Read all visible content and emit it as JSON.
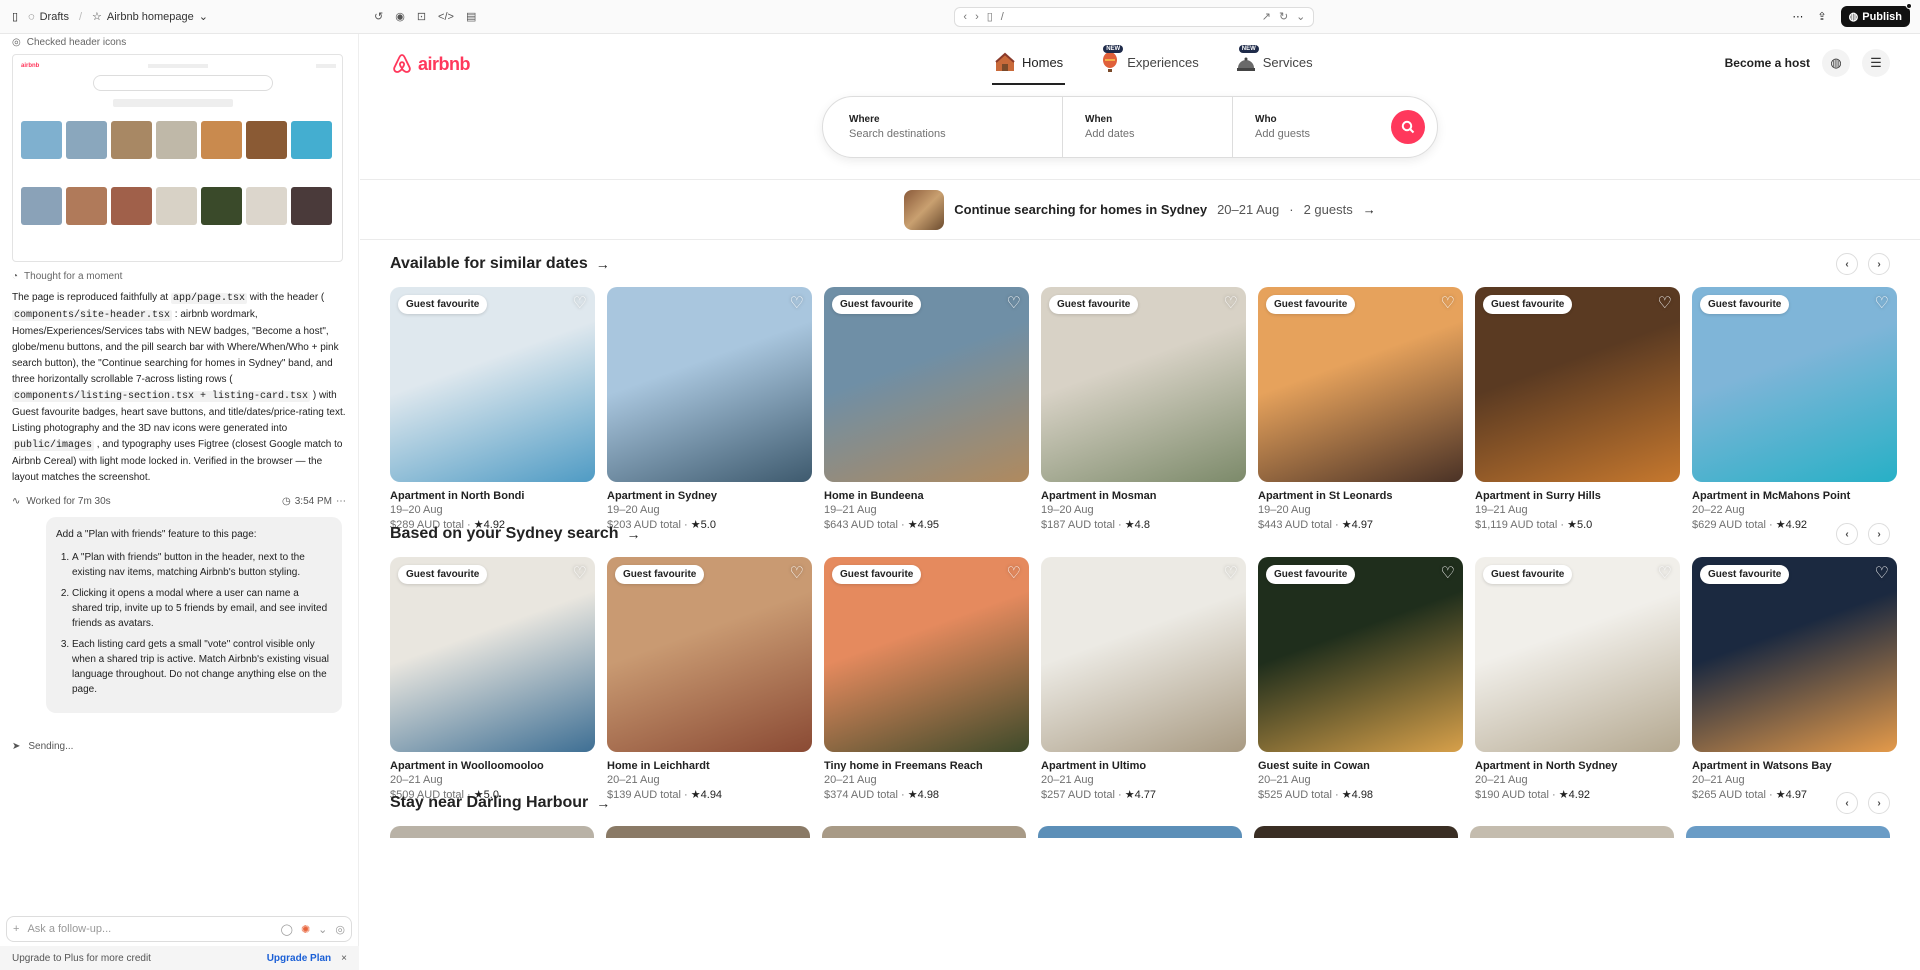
{
  "topbar": {
    "drafts": "Drafts",
    "project": "Airbnb homepage",
    "url": "/",
    "publish": "Publish"
  },
  "chat": {
    "checked": "Checked header icons",
    "thought": "Thought for a moment",
    "summary": {
      "p1": "The page is reproduced faithfully at ",
      "c1": "app/page.tsx",
      "p2": " with the header ( ",
      "c2": "components/site-header.tsx",
      "p3": " : airbnb wordmark, Homes/Experiences/Services tabs with NEW badges, \"Become a host\", globe/menu buttons, and the pill search bar with Where/When/Who + pink search button), the \"Continue searching for homes in Sydney\" band, and three horizontally scrollable 7-across listing rows ( ",
      "c3": "components/listing-section.tsx + listing-card.tsx",
      "p4": " ) with Guest favourite badges, heart save buttons, and title/dates/price-rating text. Listing photography and the 3D nav icons were generated into ",
      "c4": "public/images",
      "p5": " , and typography uses Figtree (closest Google match to Airbnb Cereal) with light mode locked in. Verified in the browser — the layout matches the screenshot."
    },
    "worked": "Worked for 7m 30s",
    "time": "3:54 PM",
    "prompt": {
      "intro": "Add a \"Plan with friends\" feature to this page:",
      "items": [
        "A \"Plan with friends\" button in the header, next to the existing nav items, matching Airbnb's button styling.",
        "Clicking it opens a modal where a user can name a shared trip, invite up to 5 friends by email, and see invited friends as avatars.",
        "Each listing card gets a small \"vote\" control visible only when a shared trip is active. Match Airbnb's existing visual language throughout. Do not change anything else on the page."
      ]
    },
    "sending": "Sending...",
    "composer_placeholder": "Ask a follow-up...",
    "upgrade_text": "Upgrade to Plus for more credit",
    "upgrade_link": "Upgrade Plan"
  },
  "site": {
    "logo": "airbnb",
    "nav": [
      {
        "label": "Homes",
        "badge": ""
      },
      {
        "label": "Experiences",
        "badge": "NEW"
      },
      {
        "label": "Services",
        "badge": "NEW"
      }
    ],
    "become_host": "Become a host",
    "search": {
      "where_label": "Where",
      "where_val": "Search destinations",
      "when_label": "When",
      "when_val": "Add dates",
      "who_label": "Who",
      "who_val": "Add guests"
    },
    "band": {
      "title": "Continue searching for homes in Sydney",
      "dates": "20–21 Aug",
      "guests": "2 guests"
    },
    "badge_text": "Guest favourite",
    "sections": [
      {
        "title": "Available for similar dates",
        "cards": [
          {
            "title": "Apartment in North Bondi",
            "dates": "19–20 Aug",
            "price": "$289 AUD total",
            "rating": "★4.92",
            "fav": true,
            "c1": "#dfe8ee",
            "c2": "#4f9bc4"
          },
          {
            "title": "Apartment in Sydney",
            "dates": "19–20 Aug",
            "price": "$203 AUD total",
            "rating": "★5.0",
            "fav": false,
            "c1": "#a9c6de",
            "c2": "#3e5a6e"
          },
          {
            "title": "Home in Bundeena",
            "dates": "19–21 Aug",
            "price": "$643 AUD total",
            "rating": "★4.95",
            "fav": true,
            "c1": "#6f8fa6",
            "c2": "#b08a5e"
          },
          {
            "title": "Apartment in Mosman",
            "dates": "19–20 Aug",
            "price": "$187 AUD total",
            "rating": "★4.8",
            "fav": true,
            "c1": "#d8d2c6",
            "c2": "#7c8a6a"
          },
          {
            "title": "Apartment in St Leonards",
            "dates": "19–20 Aug",
            "price": "$443 AUD total",
            "rating": "★4.97",
            "fav": true,
            "c1": "#e6a25c",
            "c2": "#4a3226"
          },
          {
            "title": "Apartment in Surry Hills",
            "dates": "19–21 Aug",
            "price": "$1,119 AUD total",
            "rating": "★5.0",
            "fav": true,
            "c1": "#5a3a22",
            "c2": "#c6782e"
          },
          {
            "title": "Apartment in McMahons Point",
            "dates": "20–22 Aug",
            "price": "$629 AUD total",
            "rating": "★4.92",
            "fav": true,
            "c1": "#7fb5d8",
            "c2": "#27b0c6"
          }
        ]
      },
      {
        "title": "Based on your Sydney search",
        "cards": [
          {
            "title": "Apartment in Woolloomooloo",
            "dates": "20–21 Aug",
            "price": "$509 AUD total",
            "rating": "★5.0",
            "fav": true,
            "c1": "#e9e6df",
            "c2": "#3e6f94"
          },
          {
            "title": "Home in Leichhardt",
            "dates": "20–21 Aug",
            "price": "$139 AUD total",
            "rating": "★4.94",
            "fav": true,
            "c1": "#c99a72",
            "c2": "#8a4a34"
          },
          {
            "title": "Tiny home in Freemans Reach",
            "dates": "20–21 Aug",
            "price": "$374 AUD total",
            "rating": "★4.98",
            "fav": true,
            "c1": "#e58a5e",
            "c2": "#3e4a2a"
          },
          {
            "title": "Apartment in Ultimo",
            "dates": "20–21 Aug",
            "price": "$257 AUD total",
            "rating": "★4.77",
            "fav": false,
            "c1": "#eceae4",
            "c2": "#a89a82"
          },
          {
            "title": "Guest suite in Cowan",
            "dates": "20–21 Aug",
            "price": "$525 AUD total",
            "rating": "★4.98",
            "fav": true,
            "c1": "#1f2e1c",
            "c2": "#d7a04a"
          },
          {
            "title": "Apartment in North Sydney",
            "dates": "20–21 Aug",
            "price": "$190 AUD total",
            "rating": "★4.92",
            "fav": true,
            "c1": "#f1efea",
            "c2": "#b4a890"
          },
          {
            "title": "Apartment in Watsons Bay",
            "dates": "20–21 Aug",
            "price": "$265 AUD total",
            "rating": "★4.97",
            "fav": true,
            "c1": "#1b2940",
            "c2": "#e49a4a"
          }
        ]
      },
      {
        "title": "Stay near Darling Harbour",
        "cards": []
      }
    ]
  }
}
